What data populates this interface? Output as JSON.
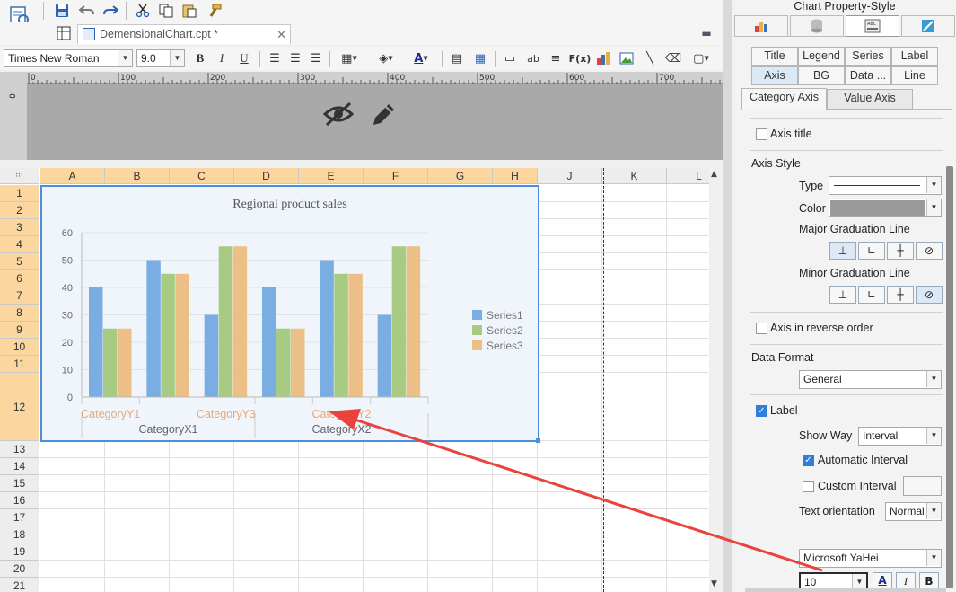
{
  "document": {
    "tab_label": "DemensionalChart.cpt *"
  },
  "font_toolbar": {
    "font_name": "Times New Roman",
    "font_size": "9.0"
  },
  "ruler": {
    "ticks": [
      "0",
      "100",
      "200",
      "300",
      "400",
      "500",
      "600",
      "700"
    ],
    "left_mark": "0"
  },
  "sheet": {
    "columns": [
      "A",
      "B",
      "C",
      "D",
      "E",
      "F",
      "G",
      "H",
      "J",
      "K",
      "L"
    ],
    "rows": [
      "1",
      "2",
      "3",
      "4",
      "5",
      "6",
      "7",
      "8",
      "9",
      "10",
      "11",
      "12",
      "13",
      "14",
      "15",
      "16",
      "17",
      "18",
      "19",
      "20",
      "21"
    ]
  },
  "chart_data": {
    "type": "bar",
    "title": "Regional product sales",
    "categories": [
      "CategoryY1",
      "CategoryY3",
      "CategoryY2",
      "CategoryY1",
      "CategoryY3",
      "CategoryY2"
    ],
    "outer_categories": [
      "CategoryX1",
      "CategoryX2"
    ],
    "visible_category_labels": [
      "CategoryY1",
      "CategoryY3",
      "CategoryY2"
    ],
    "series": [
      {
        "name": "Series1",
        "color": "#7aaee3",
        "values": [
          40,
          50,
          30,
          40,
          50,
          30
        ]
      },
      {
        "name": "Series2",
        "color": "#a7cb82",
        "values": [
          25,
          45,
          55,
          25,
          45,
          55
        ]
      },
      {
        "name": "Series3",
        "color": "#ebbf86",
        "values": [
          25,
          45,
          55,
          25,
          45,
          55
        ]
      }
    ],
    "yticks": [
      "0",
      "10",
      "20",
      "30",
      "40",
      "50",
      "60"
    ],
    "ylim": [
      0,
      60
    ],
    "grid": true,
    "legend_position": "right",
    "category_label_color": "#e8a87c"
  },
  "panel": {
    "title": "Chart Property-Style",
    "style_tabs_row1": [
      "Title",
      "Legend",
      "Series",
      "Label"
    ],
    "style_tabs_row2": [
      "Axis",
      "BG",
      "Data ...",
      "Line"
    ],
    "axis_tabs": [
      "Category Axis",
      "Value Axis"
    ],
    "axis_title_label": "Axis title",
    "axis_style_label": "Axis Style",
    "type_label": "Type",
    "color_label": "Color",
    "axis_color": "#9a9a9a",
    "major_label": "Major Graduation Line",
    "minor_label": "Minor Graduation Line",
    "reverse_label": "Axis in reverse order",
    "data_format_label": "Data Format",
    "data_format_value": "General",
    "label_check": "Label",
    "show_way_label": "Show Way",
    "show_way_value": "Interval",
    "auto_interval_label": "Automatic Interval",
    "custom_interval_label": "Custom Interval",
    "text_orientation_label": "Text orientation",
    "text_orientation_value": "Normal",
    "font_value": "Microsoft YaHei",
    "font_size_value": "10",
    "italic_label": "I",
    "bold_label": "B",
    "font_color_label": "A"
  }
}
